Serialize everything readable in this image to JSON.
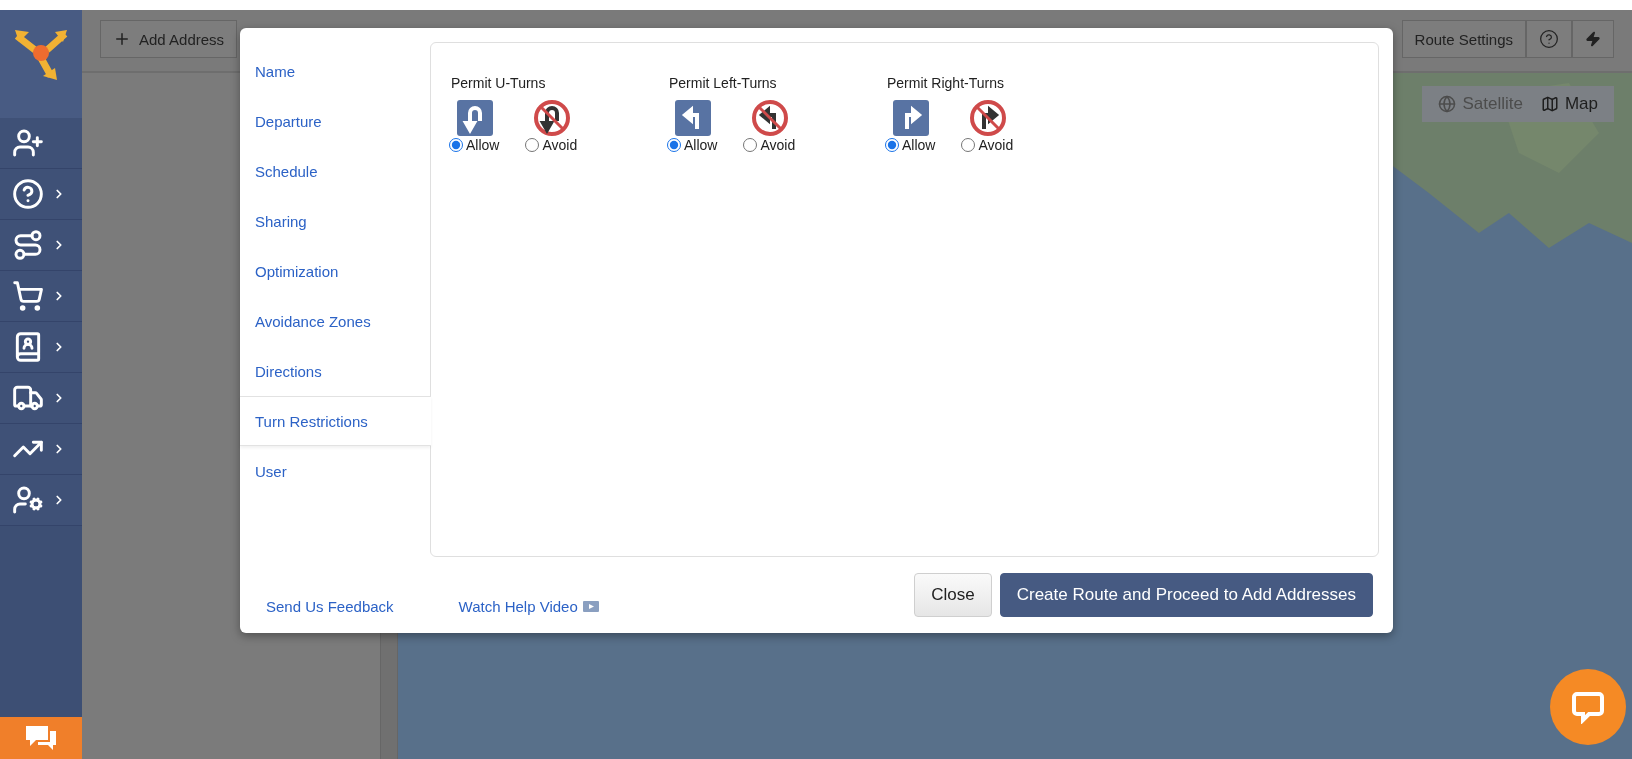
{
  "sidebar": {
    "items": [
      {
        "kind": "add-user",
        "expandable": false
      },
      {
        "kind": "help",
        "expandable": true
      },
      {
        "kind": "routes",
        "expandable": true
      },
      {
        "kind": "cart",
        "expandable": true
      },
      {
        "kind": "addresses",
        "expandable": true
      },
      {
        "kind": "team",
        "expandable": true
      },
      {
        "kind": "analytics",
        "expandable": true
      },
      {
        "kind": "settings",
        "expandable": true
      }
    ]
  },
  "toolbar": {
    "add_button": "Add Address",
    "route_settings": "Route Settings"
  },
  "map": {
    "type_buttons": [
      {
        "label": "Satellite",
        "selected": false
      },
      {
        "label": "Map",
        "selected": true
      }
    ]
  },
  "dialog": {
    "nav": [
      {
        "label": "Name",
        "selected": false
      },
      {
        "label": "Departure",
        "selected": false
      },
      {
        "label": "Schedule",
        "selected": false
      },
      {
        "label": "Sharing",
        "selected": false
      },
      {
        "label": "Optimization",
        "selected": false
      },
      {
        "label": "Avoidance Zones",
        "selected": false
      },
      {
        "label": "Directions",
        "selected": false
      },
      {
        "label": "Turn Restrictions",
        "selected": true
      },
      {
        "label": "User",
        "selected": false
      }
    ],
    "sections": [
      {
        "title": "Permit U-Turns",
        "kind": "u-turn",
        "options": [
          {
            "label": "Allow",
            "selected": true
          },
          {
            "label": "Avoid",
            "selected": false
          }
        ]
      },
      {
        "title": "Permit Left-Turns",
        "kind": "left",
        "options": [
          {
            "label": "Allow",
            "selected": true
          },
          {
            "label": "Avoid",
            "selected": false
          }
        ]
      },
      {
        "title": "Permit Right-Turns",
        "kind": "right",
        "options": [
          {
            "label": "Allow",
            "selected": true
          },
          {
            "label": "Avoid",
            "selected": false
          }
        ]
      }
    ],
    "footer_links": [
      "Send Us Feedback",
      "Watch Help Video"
    ],
    "buttons": [
      {
        "label": "Close",
        "kind": "secondary"
      },
      {
        "label": "Create Route and Proceed to Add Addresses",
        "kind": "primary"
      }
    ]
  }
}
